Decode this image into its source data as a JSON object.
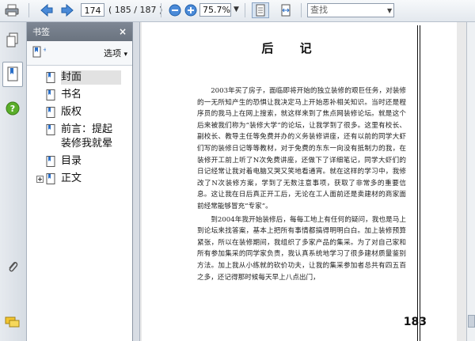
{
  "toolbar": {
    "page_number": "174",
    "page_count": "( 185 / 187 )",
    "zoom": "75.7%",
    "search_placeholder": "查找",
    "icons": [
      "print-icon",
      "previous-page-icon",
      "next-page-icon",
      "zoom-out-icon",
      "zoom-in-icon",
      "fit-page-icon",
      "fit-width-icon"
    ]
  },
  "leftbar": {
    "icons": [
      "pages-icon",
      "bookmarks-icon",
      "help-icon",
      "attachments-icon",
      "comments-icon"
    ]
  },
  "bookmarks": {
    "title": "书签",
    "close": "×",
    "options_label": "选项",
    "options_arrow": "▾",
    "items": [
      {
        "label": "封面",
        "selected": true,
        "expandable": false
      },
      {
        "label": "书名",
        "selected": false,
        "expandable": false
      },
      {
        "label": "版权",
        "selected": false,
        "expandable": false
      },
      {
        "label": "前言：提起装修我就晕",
        "selected": false,
        "expandable": false
      },
      {
        "label": "目录",
        "selected": false,
        "expandable": false
      },
      {
        "label": "正文",
        "selected": false,
        "expandable": true
      }
    ]
  },
  "document": {
    "title": "后 记",
    "paragraph_1": "2003年买了房子，面临即将开始的独立装修的艰巨任务，对装修的一无所知产生的恐惧让我决定马上开始恶补相关知识。当时还是程序员的我马上在网上搜索，就这样来到了焦点网装修论坛。就是这个后来被我们称为“装修大学”的论坛，让我学到了很多。这里有校长、副校长、教导主任等免费并办的义务装修讲座，还有以前的同学大虾们写的装修日记等等教材，对于免费的东东一向没有抵制力的我，在装修开工前上听了N次免费讲座，还做下了详细笔记，同学大虾们的日记经常让我对着电脑又哭又笑地看通宵。就在这样的学习中，我修改了N次装修方案，学到了无数注意事项，获取了非常多的重要信息。这让我在日后真正开工后，无论在工人面前还是卖建材的商家面前经常能够冒充“专家”。",
    "paragraph_2": "到2004年我开始装修后，每每工地上有任何的疑问，我也是马上到论坛来找答案，基本上把所有事情都搞得明明白白。加上装修预算紧张，所以在装修期间，我组织了多家产品的集采。为了对自己家和所有参加集采的同学家负责，我认真系统地学习了很多建材质量鉴别方法。加上我从小练就的砍价功夫，让我的集采参加者总共有四五百之多，还记得那时候每天早上八点出门，",
    "page_number": "183"
  }
}
